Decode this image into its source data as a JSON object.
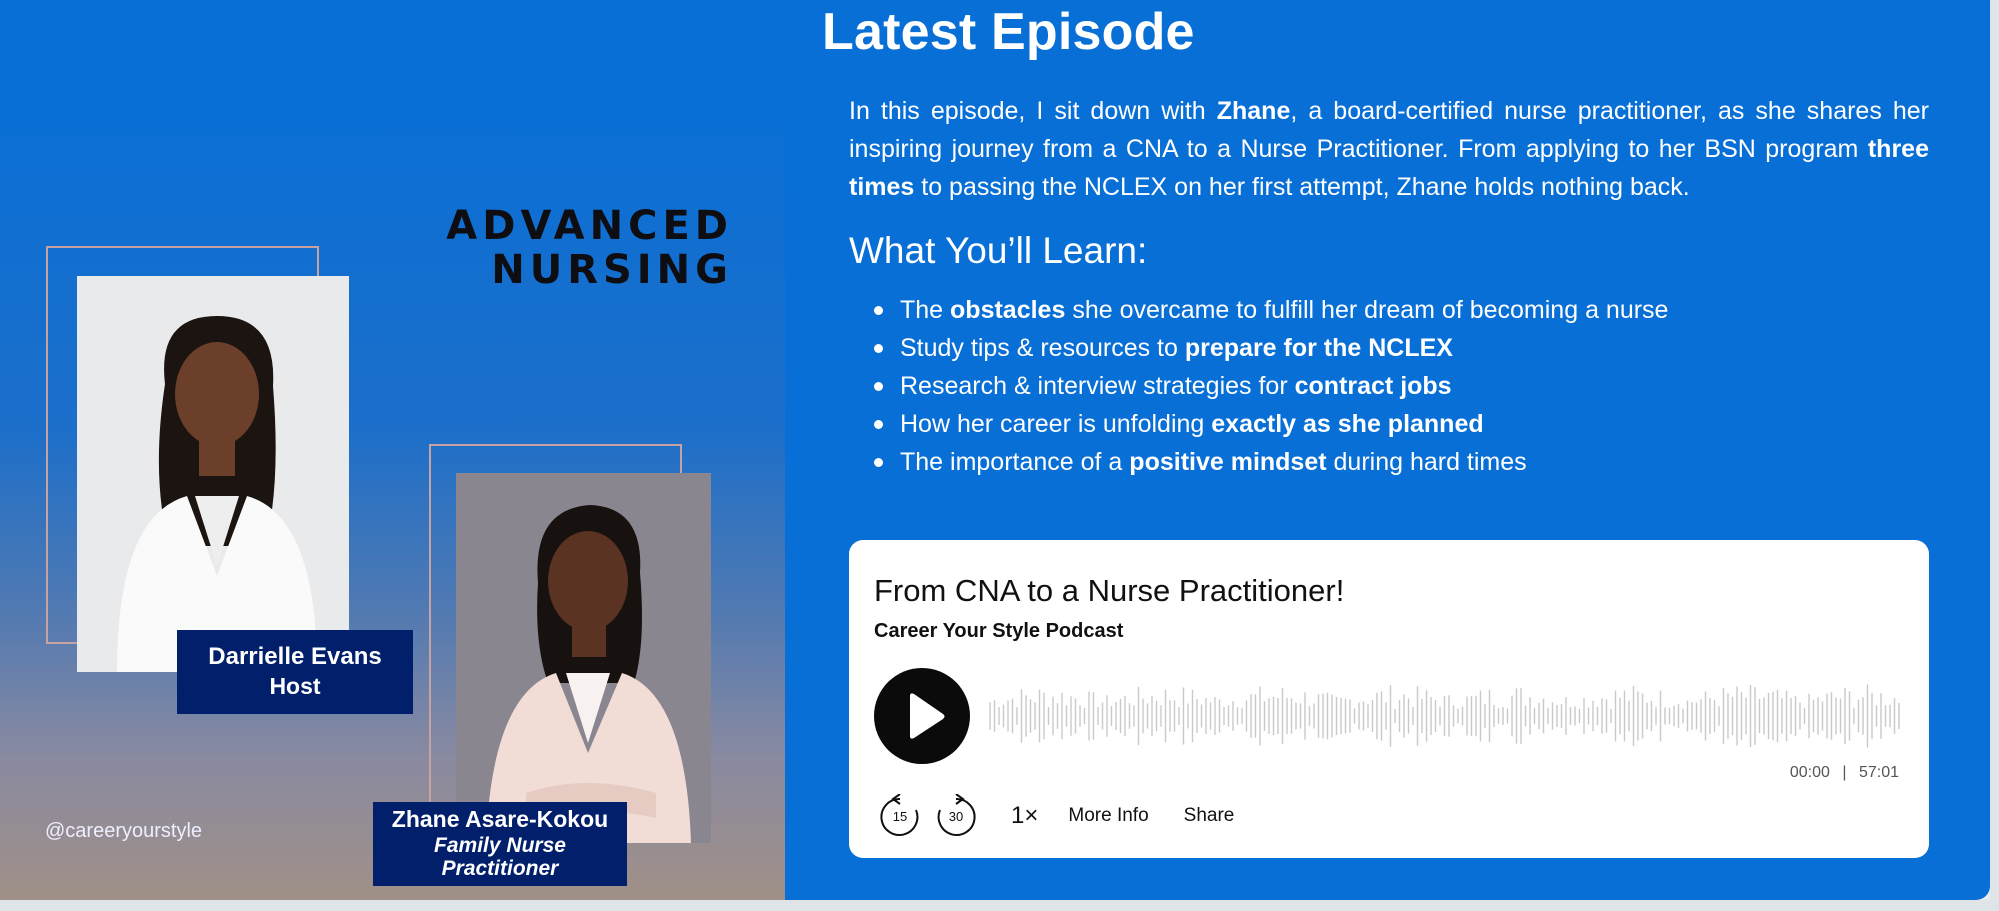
{
  "section": {
    "title": "Latest Episode"
  },
  "art": {
    "title_line1": "ADVANCED",
    "title_line2": "NURSING",
    "host_name": "Darrielle Evans",
    "host_role": "Host",
    "guest_name": "Zhane Asare-Kokou",
    "guest_role_line1": "Family Nurse",
    "guest_role_line2": "Practitioner",
    "handle": "@careeryourstyle"
  },
  "description": {
    "p1": "In this episode, I sit down with ",
    "guest": "Zhane",
    "p2": ", a board-certified nurse practitioner, as she shares her inspiring journey from a CNA to a Nurse Practitioner. From applying to her BSN program ",
    "emph": "three times",
    "p3": " to passing the NCLEX on her first attempt, Zhane holds nothing back."
  },
  "learn": {
    "title": "What You’ll Learn:",
    "items": [
      {
        "pre": "The ",
        "bold": "obstacles",
        "post": " she overcame to fulfill her dream of becoming a nurse"
      },
      {
        "pre": "Study tips & resources to ",
        "bold": "prepare for the NCLEX",
        "post": ""
      },
      {
        "pre": "Research & interview strategies for ",
        "bold": "contract jobs",
        "post": ""
      },
      {
        "pre": "How her career is unfolding ",
        "bold": "exactly as she planned",
        "post": ""
      },
      {
        "pre": "The importance of a ",
        "bold": "positive mindset",
        "post": " during hard times"
      }
    ]
  },
  "player": {
    "episode_title": "From CNA to a Nurse Practitioner!",
    "show_title": "Career Your Style Podcast",
    "time_current": "00:00",
    "time_separator": "|",
    "time_total": "57:01",
    "skip_back": "15",
    "skip_forward": "30",
    "speed": "1×",
    "more_info": "More Info",
    "share": "Share",
    "progress": 0
  },
  "colors": {
    "background": "#086fd6",
    "card": "#ffffff",
    "tag": "#021f6b"
  },
  "icons": [
    "play-icon",
    "skip-back-15-icon",
    "skip-forward-30-icon"
  ]
}
